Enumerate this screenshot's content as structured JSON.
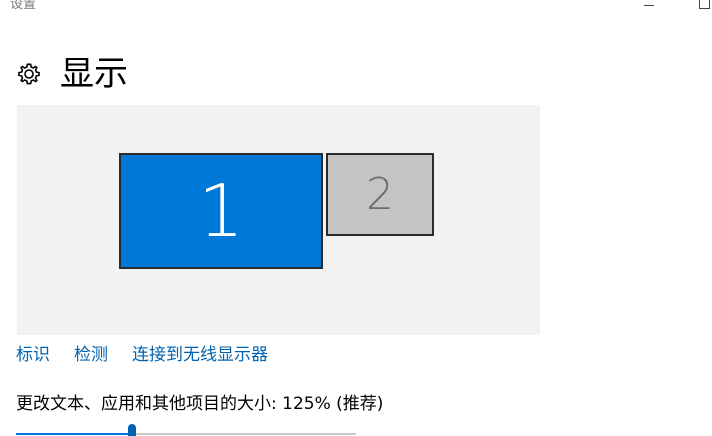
{
  "window": {
    "title": "设置"
  },
  "header": {
    "title": "显示",
    "icon": "gear-icon"
  },
  "displays": [
    {
      "label": "1",
      "selected": true
    },
    {
      "label": "2",
      "selected": false
    }
  ],
  "links": {
    "identify": "标识",
    "detect": "检测",
    "connect_wireless": "连接到无线显示器"
  },
  "scale": {
    "label": "更改文本、应用和其他项目的大小: 125% (推荐)",
    "value_fraction": 0.34
  },
  "colors": {
    "accent": "#0078d7",
    "link": "#0063b1",
    "area_bg": "#f2f2f2",
    "inactive_display": "#c4c4c4"
  }
}
